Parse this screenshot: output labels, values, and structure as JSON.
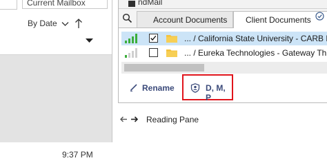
{
  "left_pane": {
    "scope_label": "Current Mailbox",
    "sort_label": "By Date",
    "selected_item_time": "9:37 PM"
  },
  "addin": {
    "title": "ndMail",
    "tabs": [
      {
        "label": "Account Documents",
        "active": false
      },
      {
        "label": "Client Documents",
        "active": true
      }
    ],
    "rows": [
      {
        "checked": true,
        "selected": true,
        "text": "... / California State University - CARB E"
      },
      {
        "checked": false,
        "selected": false,
        "text": "... / Eureka Technologies - Gateway Th"
      }
    ],
    "actions": {
      "rename_label": "Rename",
      "dmp_label": "D, M, P"
    }
  },
  "reading_pane": {
    "label": "Reading Pane"
  },
  "colors": {
    "selected_row": "#cce4f7",
    "signal_green": "#3cae3c",
    "folder": "#f4c23b",
    "highlight_border": "#e0141b",
    "action_text": "#3b4a7a"
  },
  "icons": [
    "search-icon",
    "checkmark-badge-icon",
    "signal-strength-icon",
    "folder-icon",
    "pencil-icon",
    "shield-user-icon",
    "arrow-left-icon",
    "arrow-right-icon",
    "sort-arrow-icon",
    "chevron-down-icon"
  ]
}
